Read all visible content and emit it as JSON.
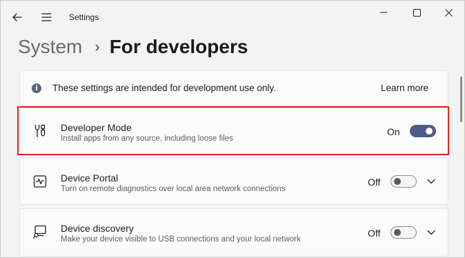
{
  "window": {
    "app_title": "Settings",
    "controls": {
      "minimize": "minimize-icon",
      "maximize": "maximize-icon",
      "close": "close-icon"
    }
  },
  "header": {
    "breadcrumb_parent": "System",
    "breadcrumb_separator": "›",
    "page_title": "For developers"
  },
  "info_banner": {
    "icon": "info-icon",
    "text": "These settings are intended for development use only.",
    "link": "Learn more"
  },
  "settings": [
    {
      "title": "Developer Mode",
      "description": "Install apps from any source, including loose files",
      "state_label": "On",
      "enabled": true,
      "icon": "tools-icon",
      "expandable": false,
      "highlighted": true
    },
    {
      "title": "Device Portal",
      "description": "Turn on remote diagnostics over local area network connections",
      "state_label": "Off",
      "enabled": false,
      "icon": "pulse-monitor-icon",
      "expandable": true
    },
    {
      "title": "Device discovery",
      "description": "Make your device visible to USB connections and your local network",
      "state_label": "Off",
      "enabled": false,
      "icon": "device-search-icon",
      "expandable": true
    }
  ],
  "colors": {
    "accent": "#4f5b8c",
    "highlight_border": "#e0201b",
    "background": "#f3f3f3",
    "card": "#fbfbfb"
  }
}
